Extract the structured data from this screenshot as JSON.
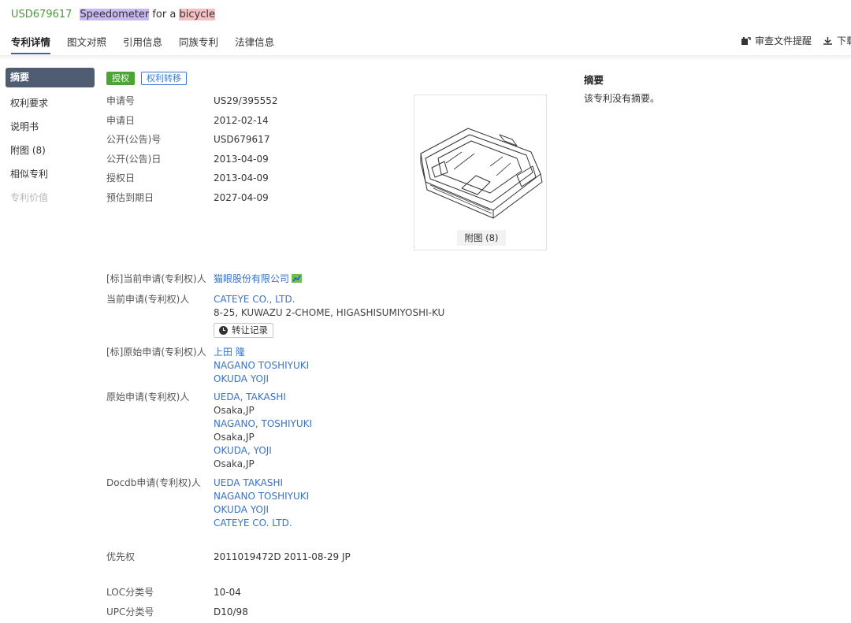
{
  "header": {
    "patent_number": "USD679617",
    "title_words": [
      "Speedometer",
      "for a",
      "bicycle"
    ]
  },
  "tabs": [
    {
      "label": "专利详情",
      "active": true
    },
    {
      "label": "图文对照"
    },
    {
      "label": "引用信息"
    },
    {
      "label": "同族专利"
    },
    {
      "label": "法律信息"
    }
  ],
  "tools": {
    "review_alert": "审查文件提醒",
    "download": "下载"
  },
  "leftnav": {
    "abstract": "摘要",
    "claims": "权利要求",
    "description": "说明书",
    "figures": "附图 (8)",
    "similar": "相似专利",
    "value": "专利价值"
  },
  "badges": {
    "granted": "授权",
    "transfer": "权利转移"
  },
  "fields": {
    "app_no": {
      "label": "申请号",
      "value": "US29/395552"
    },
    "app_date": {
      "label": "申请日",
      "value": "2012-02-14"
    },
    "pub_no": {
      "label": "公开(公告)号",
      "value": "USD679617"
    },
    "pub_date": {
      "label": "公开(公告)日",
      "value": "2013-04-09"
    },
    "grant_date": {
      "label": "授权日",
      "value": "2013-04-09"
    },
    "expiry": {
      "label": "预估到期日",
      "value": "2027-04-09"
    }
  },
  "figure": {
    "label": "附图 (8)"
  },
  "abstract": {
    "title": "摘要",
    "text": "该专利没有摘要。"
  },
  "applicants": {
    "std_current_label": "[标]当前申请(专利权)人",
    "std_current_value": "猫眼股份有限公司",
    "current_label": "当前申请(专利权)人",
    "current_name": "CATEYE CO., LTD.",
    "current_address": "8-25, KUWAZU 2-CHOME, HIGASHISUMIYOSHI-KU",
    "transfer_record": "转让记录",
    "std_original_label": "[标]原始申请(专利权)人",
    "std_original_values": [
      "上田 隆",
      "NAGANO TOSHIYUKI",
      "OKUDA YOJI"
    ],
    "original_label": "原始申请(专利权)人",
    "original_values": [
      {
        "name": "UEDA, TAKASHI",
        "loc": "Osaka,JP"
      },
      {
        "name": "NAGANO, TOSHIYUKI",
        "loc": "Osaka,JP"
      },
      {
        "name": "OKUDA, YOJI",
        "loc": "Osaka,JP"
      }
    ],
    "docdb_label": "Docdb申请(专利权)人",
    "docdb_values": [
      "UEDA TAKASHI",
      "NAGANO TOSHIYUKI",
      "OKUDA YOJI",
      "CATEYE CO. LTD."
    ]
  },
  "priority": {
    "label": "优先权",
    "value": "2011019472D 2011-08-29 JP"
  },
  "loc": {
    "label": "LOC分类号",
    "value": "10-04"
  },
  "upc": {
    "label": "UPC分类号",
    "value": "D10/98"
  }
}
